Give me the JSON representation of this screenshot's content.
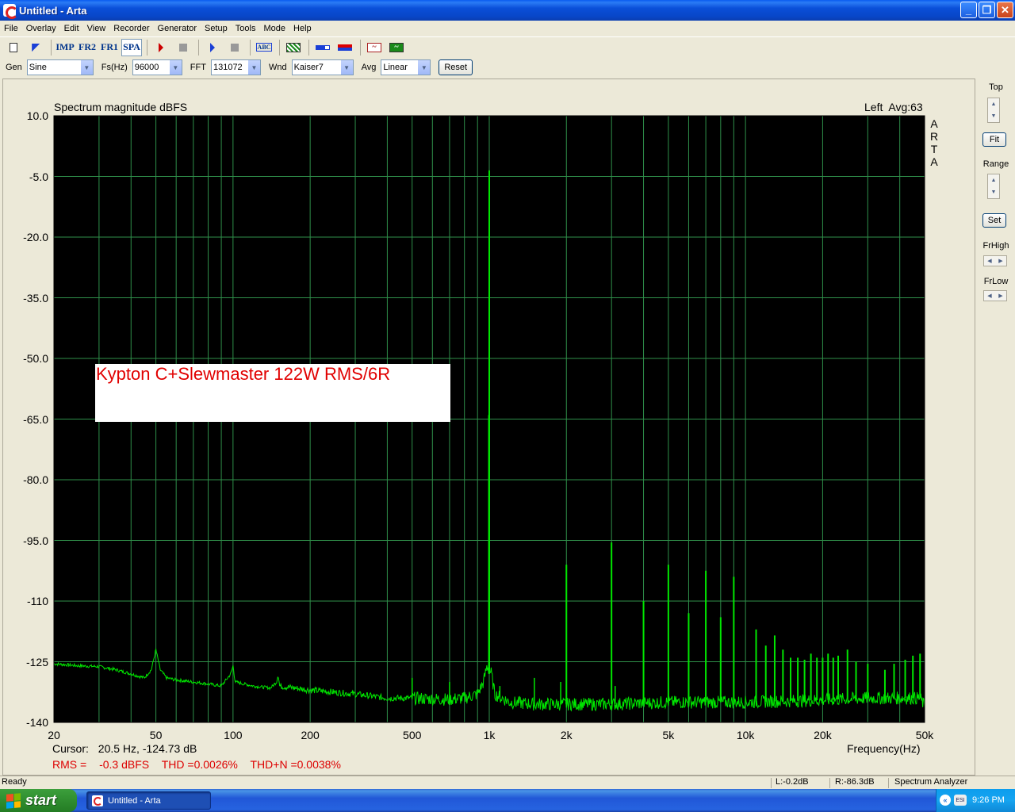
{
  "window": {
    "title": "Untitled - Arta"
  },
  "menu": [
    "File",
    "Overlay",
    "Edit",
    "View",
    "Recorder",
    "Generator",
    "Setup",
    "Tools",
    "Mode",
    "Help"
  ],
  "toolbar": {
    "imp": "IMP",
    "fr2": "FR2",
    "fr1": "FR1",
    "spa": "SPA",
    "abc": "ABC"
  },
  "controls": {
    "gen_label": "Gen",
    "gen_value": "Sine",
    "fs_label": "Fs(Hz)",
    "fs_value": "96000",
    "fft_label": "FFT",
    "fft_value": "131072",
    "wnd_label": "Wnd",
    "wnd_value": "Kaiser7",
    "avg_label": "Avg",
    "avg_value": "Linear",
    "reset_label": "Reset"
  },
  "plot": {
    "title": "Spectrum magnitude dBFS",
    "status": "Left  Avg:63",
    "arta_letters": [
      "A",
      "R",
      "T",
      "A"
    ],
    "annotation": "Kypton C+Slewmaster 122W RMS/6R",
    "cursor_label": "Cursor:",
    "cursor_value": "20.5 Hz, -124.73 dB",
    "freq_axis_label": "Frequency(Hz)",
    "rms_label": "RMS =",
    "rms_value": "-0.3 dBFS",
    "thd": "THD =0.0026%",
    "thdn": "THD+N =0.0038%"
  },
  "sidebar": {
    "top_label": "Top",
    "fit_label": "Fit",
    "range_label": "Range",
    "set_label": "Set",
    "frhigh_label": "FrHigh",
    "frlow_label": "FrLow"
  },
  "statusbar": {
    "ready": "Ready",
    "left_level": "L:-0.2dB",
    "right_level": "R:-86.3dB",
    "mode": "Spectrum Analyzer"
  },
  "taskbar": {
    "start": "start",
    "task": "Untitled - Arta",
    "clock": "9:26 PM",
    "tray_icon": "ESI"
  },
  "colors": {
    "trace": "#00e600",
    "grid": "#2f8f4a",
    "plot_bg": "#000000",
    "annotation_text": "#e10000"
  },
  "chart_data": {
    "type": "line",
    "title": "Spectrum magnitude dBFS",
    "xlabel": "Frequency(Hz)",
    "ylabel": "",
    "x_scale": "log",
    "xlim": [
      20,
      50000
    ],
    "ylim": [
      -140,
      10
    ],
    "y_ticks": [
      "10.0",
      "-5.0",
      "-20.0",
      "-35.0",
      "-50.0",
      "-65.0",
      "-80.0",
      "-95.0",
      "-110",
      "-125",
      "-140"
    ],
    "y_tick_values": [
      10,
      -5,
      -20,
      -35,
      -50,
      -65,
      -80,
      -95,
      -110,
      -125,
      -140
    ],
    "x_ticks": [
      "20",
      "50",
      "100",
      "200",
      "500",
      "1k",
      "2k",
      "5k",
      "10k",
      "20k",
      "50k"
    ],
    "x_tick_values": [
      20,
      50,
      100,
      200,
      500,
      1000,
      2000,
      5000,
      10000,
      20000,
      50000
    ],
    "grid": true,
    "series": [
      {
        "values": [
          [
            20,
            -125.5
          ],
          [
            25,
            -126
          ],
          [
            30,
            -126.2
          ],
          [
            35,
            -127
          ],
          [
            40,
            -128
          ],
          [
            45,
            -129
          ],
          [
            48,
            -127
          ],
          [
            50,
            -122
          ],
          [
            52,
            -127
          ],
          [
            55,
            -129
          ],
          [
            60,
            -129.5
          ],
          [
            70,
            -130
          ],
          [
            80,
            -130.5
          ],
          [
            90,
            -131
          ],
          [
            98,
            -128
          ],
          [
            100,
            -126
          ],
          [
            102,
            -130
          ],
          [
            120,
            -131
          ],
          [
            140,
            -131.5
          ],
          [
            148,
            -130
          ],
          [
            150,
            -128
          ],
          [
            152,
            -131
          ],
          [
            200,
            -132
          ],
          [
            300,
            -133
          ],
          [
            400,
            -134
          ],
          [
            500,
            -134
          ],
          [
            600,
            -134.2
          ],
          [
            700,
            -134.3
          ],
          [
            800,
            -134
          ],
          [
            900,
            -133
          ],
          [
            950,
            -130
          ],
          [
            980,
            -126
          ],
          [
            1000,
            -3.5
          ],
          [
            1020,
            -128
          ],
          [
            1050,
            -133
          ],
          [
            1200,
            -135
          ],
          [
            1500,
            -135.5
          ],
          [
            2000,
            -135.5
          ],
          [
            3000,
            -135.5
          ],
          [
            5000,
            -135
          ],
          [
            10000,
            -135
          ],
          [
            20000,
            -134.5
          ],
          [
            30000,
            -134
          ],
          [
            40000,
            -134
          ],
          [
            48000,
            -134
          ],
          [
            50000,
            -136
          ]
        ]
      }
    ],
    "harmonics": [
      [
        1000,
        -3.5
      ],
      [
        2000,
        -101
      ],
      [
        3000,
        -95.5
      ],
      [
        4000,
        -110
      ],
      [
        5000,
        -101
      ],
      [
        6000,
        -113
      ],
      [
        7000,
        -102.5
      ],
      [
        8000,
        -114
      ],
      [
        9000,
        -104
      ],
      [
        11000,
        -117
      ],
      [
        12000,
        -121
      ],
      [
        13000,
        -118.5
      ],
      [
        14000,
        -122
      ],
      [
        15000,
        -124
      ],
      [
        16000,
        -124
      ],
      [
        17000,
        -124.5
      ],
      [
        18000,
        -123
      ],
      [
        19000,
        -124
      ],
      [
        20000,
        -124
      ],
      [
        21000,
        -123
      ],
      [
        22000,
        -124
      ],
      [
        23000,
        -123.5
      ],
      [
        25000,
        -122
      ],
      [
        27000,
        -125
      ],
      [
        30000,
        -125.5
      ],
      [
        35000,
        -127
      ],
      [
        38000,
        -125.5
      ],
      [
        42000,
        -124.5
      ],
      [
        45000,
        -123.5
      ],
      [
        48000,
        -123
      ]
    ],
    "minor_spurs": [
      [
        500,
        -129
      ],
      [
        700,
        -130
      ],
      [
        1100,
        -131
      ],
      [
        1500,
        -129
      ],
      [
        1900,
        -130
      ],
      [
        3100,
        -131
      ]
    ]
  }
}
